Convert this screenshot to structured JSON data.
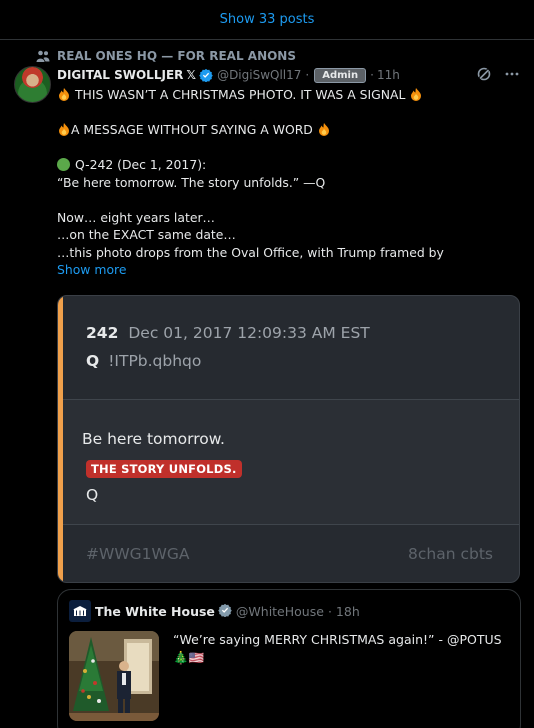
{
  "feed": {
    "show_posts_label": "Show 33 posts"
  },
  "social_context": {
    "label": "REAL ONES HQ — FOR REAL ANONS",
    "icon": "community-icon"
  },
  "post": {
    "author_name": "DIGITAL SWOLLJER",
    "author_name_suffix": "𝕏",
    "handle": "@DigiSwQll17",
    "separator": "·",
    "badge": "Admin",
    "time": "11h",
    "lines": [
      "THIS WASN’T A CHRISTMAS PHOTO. IT WAS A SIGNAL",
      "A MESSAGE WITHOUT SAYING A WORD",
      "Q-242 (Dec 1, 2017):",
      "“Be here tomorrow. The story unfolds.” —Q",
      "Now… eight years later…",
      "…on the EXACT same date…",
      "…this photo drops from the Oval Office, with Trump framed by"
    ],
    "show_more": "Show more",
    "accent_color": "#1d9bf0"
  },
  "q_card": {
    "post_number": "242",
    "timestamp": "Dec 01, 2017 12:09:33 AM EST",
    "author": "Q",
    "tripcode": "!ITPb.qbhqo",
    "line1": "Be here tomorrow.",
    "highlight": "THE STORY UNFOLDS.",
    "signature": "Q",
    "footer_left": "#WWG1WGA",
    "footer_right": "8chan cbts",
    "accent_color": "#f0a04b",
    "highlight_color": "#c0302b"
  },
  "quote": {
    "name": "The White House",
    "handle": "@WhiteHouse",
    "separator": "·",
    "time": "18h",
    "text": "“We’re saying MERRY CHRISTMAS again!” - @POTUS",
    "emojis": "🎄🇺🇸"
  }
}
